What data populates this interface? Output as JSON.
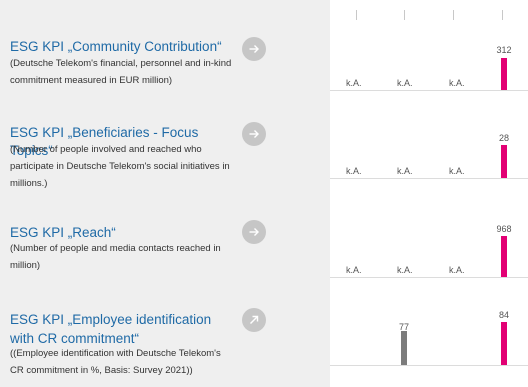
{
  "colors": {
    "accent": "#e20074",
    "title_blue": "#1f6aa6",
    "gray_bar": "#7c7c7c",
    "button_gray": "#c6c6c6"
  },
  "rows": [
    {
      "title": "ESG KPI „Community Contribution“",
      "description": "(Deutsche Telekom's financial, personnel and in-kind commitment measured in EUR million)",
      "button_icon": "arrow-right-icon",
      "na_labels": [
        "k.A.",
        "k.A.",
        "k.A."
      ],
      "current_value": "312"
    },
    {
      "title": "ESG KPI „Beneficiaries - Focus Topics“",
      "description": "(Number of people involved and reached who participate in Deutsche Telekom's social initiatives in millions.)",
      "button_icon": "arrow-right-icon",
      "na_labels": [
        "k.A.",
        "k.A.",
        "k.A."
      ],
      "current_value": "28"
    },
    {
      "title": "ESG KPI „Reach“",
      "description": "(Number of people and media contacts reached in million)",
      "button_icon": "arrow-right-icon",
      "na_labels": [
        "k.A.",
        "k.A.",
        "k.A."
      ],
      "current_value": "968"
    },
    {
      "title": "ESG KPI „Employee identification with CR commitment“",
      "description": "((Employee identification with Deutsche Telekom's CR commitment in %, Basis: Survey 2021))",
      "button_icon": "arrow-up-right-icon",
      "prior_value": "77",
      "current_value": "84"
    }
  ]
}
